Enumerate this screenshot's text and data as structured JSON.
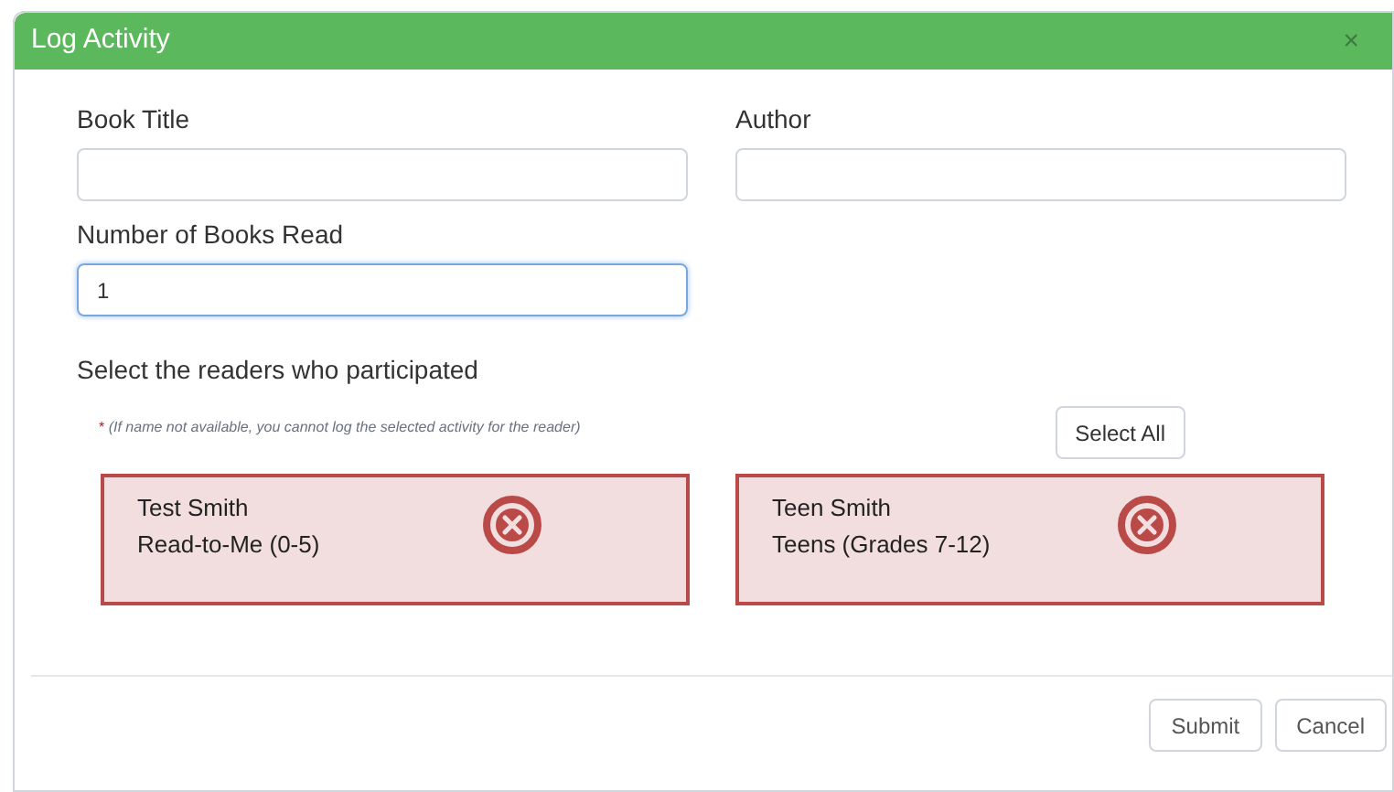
{
  "dialog": {
    "title": "Log Activity",
    "close": "×"
  },
  "fields": [
    {
      "label": "Book Title",
      "focused": false
    },
    {
      "label": "Author",
      "focused": false
    },
    {
      "label": "Number of Books Read",
      "value": "1",
      "focused": true
    }
  ],
  "readers_heading": "Select the readers who participated",
  "note": {
    "mark": "*",
    "text": "(If name not available, you cannot log the selected activity for the reader)"
  },
  "select_all": "Select All",
  "readers": [
    {
      "name": "Test Smith",
      "group": "Read-to-Me (0-5)",
      "available": false
    },
    {
      "name": "Teen Smith",
      "group": "Teens (Grades 7-12)",
      "available": false
    }
  ],
  "buttons": [
    "Submit",
    "Cancel"
  ]
}
